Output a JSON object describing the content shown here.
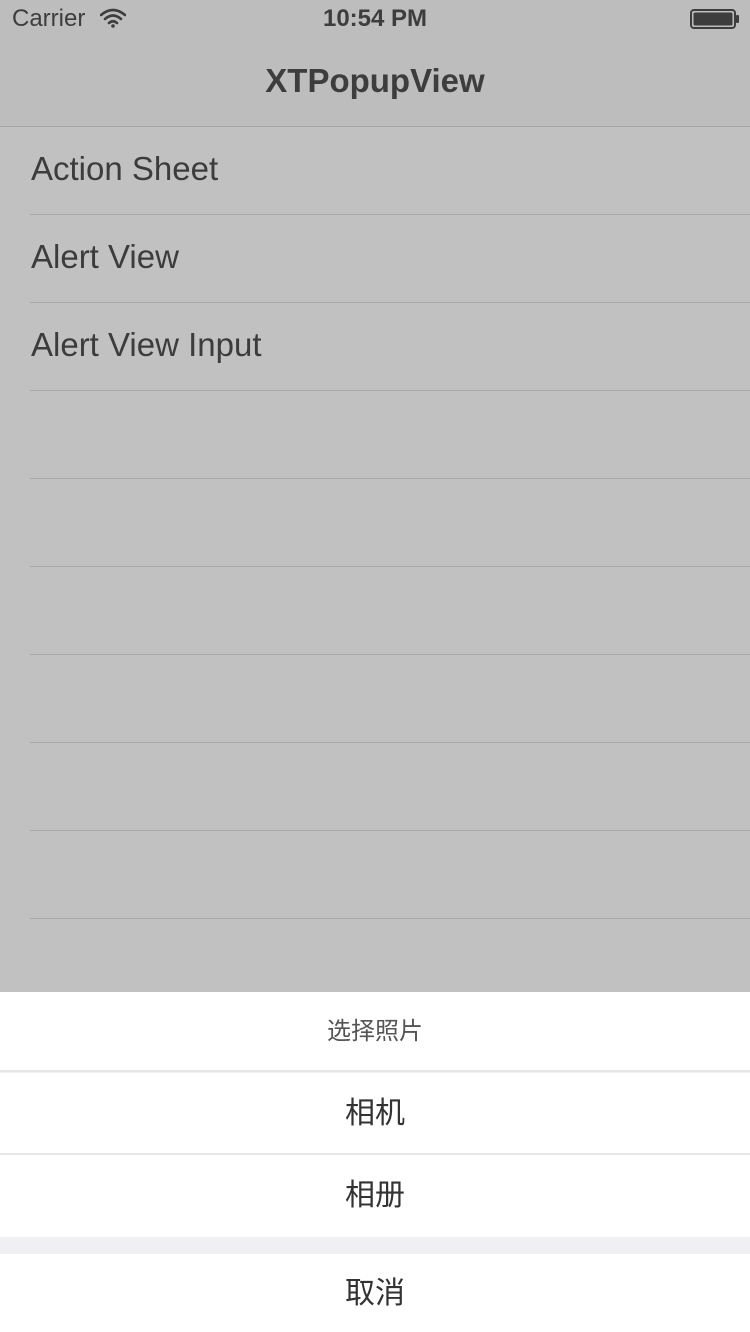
{
  "status_bar": {
    "carrier": "Carrier",
    "time": "10:54 PM",
    "wifi_icon": "wifi-icon",
    "battery_icon": "battery-icon"
  },
  "nav": {
    "title": "XTPopupView"
  },
  "table": {
    "rows": [
      {
        "label": "Action Sheet"
      },
      {
        "label": "Alert View"
      },
      {
        "label": "Alert View Input"
      },
      {
        "label": ""
      },
      {
        "label": ""
      },
      {
        "label": ""
      },
      {
        "label": ""
      },
      {
        "label": ""
      },
      {
        "label": ""
      },
      {
        "label": ""
      }
    ]
  },
  "action_sheet": {
    "title": "选择照片",
    "options": [
      "相机",
      "相册"
    ],
    "cancel": "取消"
  },
  "colors": {
    "dimmed_background": "#c1c1c1",
    "sheet_background": "#ffffff",
    "sheet_gap": "#efeff4",
    "text_primary": "#333333"
  }
}
